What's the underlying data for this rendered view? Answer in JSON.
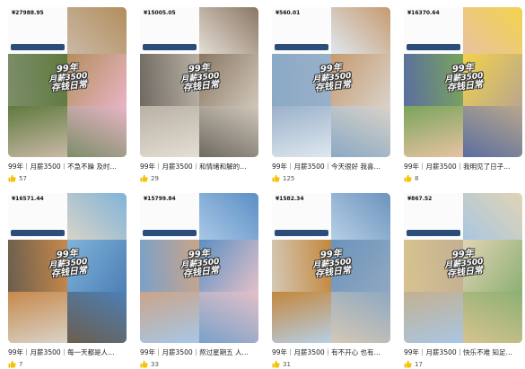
{
  "cards": [
    {
      "balance": "¥27988.95",
      "title": "99年｜月薪3500｜不急不躁 及时…",
      "likes": "57",
      "overlay": [
        "99年",
        "月薪3500",
        "存钱日常"
      ],
      "colors": [
        "#c9b9a6",
        "#7c8e6a",
        "#b38e5d",
        "#5f7a3e",
        "#e8b4c4"
      ]
    },
    {
      "balance": "¥15005.05",
      "title": "99年｜月薪3500｜和情绪和解的…",
      "likes": "29",
      "overlay": [
        "99年",
        "月薪3500",
        "存钱日常"
      ],
      "colors": [
        "#e4ded4",
        "#6f6a62",
        "#8a7763",
        "#b9b1a4",
        "#cfc6b8"
      ]
    },
    {
      "balance": "¥560.01",
      "title": "99年｜月薪3500｜今天很好 我喜…",
      "likes": "125",
      "overlay": [
        "99年",
        "月薪3500",
        "存钱日常"
      ],
      "colors": [
        "#dfe7ef",
        "#8aa9c5",
        "#c69a6f",
        "#9ab1c9",
        "#d9d2c8"
      ]
    },
    {
      "balance": "¥16370.64",
      "title": "99年｜月薪3500｜我明见了日子…",
      "likes": "8",
      "overlay": [
        "99年",
        "月薪3500",
        "存钱日常"
      ],
      "colors": [
        "#e8c3a2",
        "#5a6ea0",
        "#f2d24c",
        "#7aa45c",
        "#b9a78c"
      ]
    },
    {
      "balance": "¥16571.44",
      "title": "99年｜月薪3500｜每一天都是人…",
      "likes": "7",
      "overlay": [
        "99年",
        "月薪3500",
        "存钱日常"
      ],
      "colors": [
        "#d9d3c8",
        "#6b5e4d",
        "#7fb4d8",
        "#c7894c",
        "#4d7fb6"
      ]
    },
    {
      "balance": "¥15799.84",
      "title": "99年｜月薪3500｜熬过星期五 人…",
      "likes": "33",
      "overlay": [
        "99年",
        "月薪3500",
        "存钱日常"
      ],
      "colors": [
        "#a8c7e6",
        "#7aa1c9",
        "#5b8fc4",
        "#caa48a",
        "#e2c0c8"
      ]
    },
    {
      "balance": "¥1582.34",
      "title": "99年｜月薪3500｜有不开心 也有…",
      "likes": "31",
      "overlay": [
        "99年",
        "月薪3500",
        "存钱日常"
      ],
      "colors": [
        "#b7cfe6",
        "#d4c8b6",
        "#6c93bd",
        "#c3873c",
        "#8fa8c0"
      ]
    },
    {
      "balance": "¥867.52",
      "title": "99年｜月薪3500｜快乐不难 知足…",
      "likes": "17",
      "overlay": [
        "99年",
        "月薪3500",
        "存钱日常"
      ],
      "colors": [
        "#a9c6e2",
        "#d7c38f",
        "#e1d4b3",
        "#c3b092",
        "#8db074"
      ]
    }
  ],
  "icons": {
    "like": "thumbs-up-icon"
  }
}
